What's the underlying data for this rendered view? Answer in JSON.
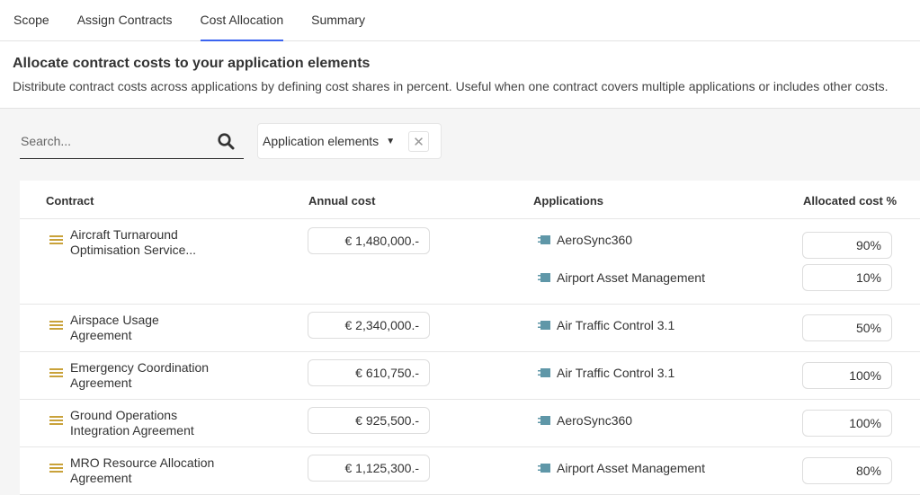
{
  "tabs": [
    {
      "label": "Scope"
    },
    {
      "label": "Assign Contracts"
    },
    {
      "label": "Cost Allocation",
      "active": true
    },
    {
      "label": "Summary"
    }
  ],
  "header": {
    "title": "Allocate contract costs to your application elements",
    "description": "Distribute contract costs across applications by defining cost shares in percent. Useful when one contract covers multiple applications or includes other costs."
  },
  "toolbar": {
    "search_placeholder": "Search...",
    "search_icon": "search-icon",
    "filter_label": "Application elements",
    "clear_icon": "close-icon"
  },
  "table": {
    "columns": [
      "Contract",
      "Annual cost",
      "Applications",
      "Allocated cost %"
    ],
    "rows": [
      {
        "contract": "Aircraft Turnaround Optimisation Service...",
        "annual_cost": "€ 1,480,000.-",
        "allocations": [
          {
            "app": "AeroSync360",
            "pct": "90%"
          },
          {
            "app": "Airport Asset Management",
            "pct": "10%"
          }
        ]
      },
      {
        "contract": "Airspace Usage Agreement",
        "annual_cost": "€ 2,340,000.-",
        "allocations": [
          {
            "app": "Air Traffic Control 3.1",
            "pct": "50%"
          }
        ]
      },
      {
        "contract": "Emergency Coordination Agreement",
        "annual_cost": "€ 610,750.-",
        "allocations": [
          {
            "app": "Air Traffic Control 3.1",
            "pct": "100%"
          }
        ]
      },
      {
        "contract": "Ground Operations Integration Agreement",
        "annual_cost": "€ 925,500.-",
        "allocations": [
          {
            "app": "AeroSync360",
            "pct": "100%"
          }
        ]
      },
      {
        "contract": "MRO Resource Allocation Agreement",
        "annual_cost": "€ 1,125,300.-",
        "allocations": [
          {
            "app": "Airport Asset Management",
            "pct": "80%"
          }
        ]
      }
    ]
  },
  "colors": {
    "accent": "#3b64f0",
    "contract_icon": "#c9a23a",
    "app_icon": "#5f97a8"
  }
}
